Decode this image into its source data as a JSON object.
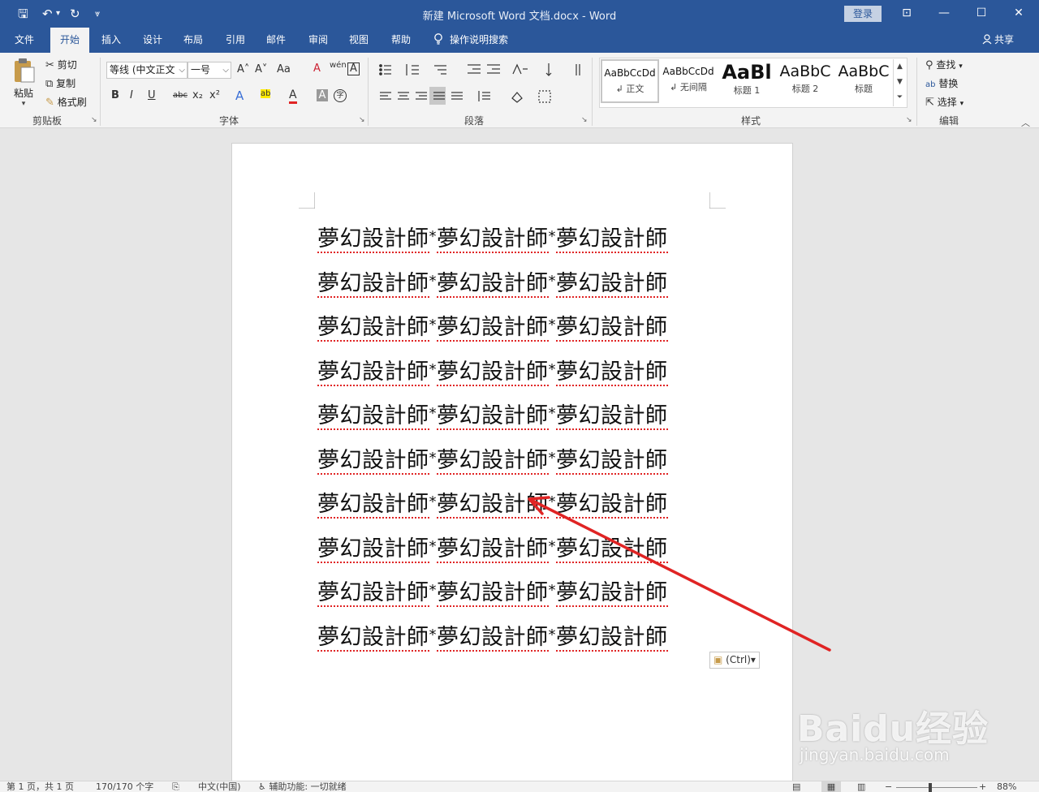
{
  "window": {
    "title": "新建 Microsoft Word 文档.docx  -  Word",
    "login_label": "登录",
    "controls": {
      "ribbon_display": "⊡",
      "minimize": "—",
      "maximize": "☐",
      "close": "✕"
    },
    "qat": {
      "save": "🖫",
      "undo": "↶",
      "undo_menu": "▾",
      "redo": "↻",
      "customize": "⩔"
    }
  },
  "tabs": {
    "file": "文件",
    "home": "开始",
    "insert": "插入",
    "design": "设计",
    "layout": "布局",
    "references": "引用",
    "mailings": "邮件",
    "review": "审阅",
    "view": "视图",
    "help": "帮助",
    "tell_me": "操作说明搜索",
    "share": "共享"
  },
  "ribbon": {
    "clipboard": {
      "label": "剪贴板",
      "paste": "粘贴",
      "cut": "剪切",
      "copy": "复制",
      "format_painter": "格式刷"
    },
    "font": {
      "label": "字体",
      "font_name": "等线 (中文正文",
      "font_size": "一号",
      "grow": "A˄",
      "shrink": "A˅",
      "change_case": "Aa",
      "clear": "A",
      "phonetic": "wén",
      "char_border": "A",
      "bold": "B",
      "italic": "I",
      "underline": "U",
      "strike": "abc",
      "sub": "x₂",
      "sup": "x²",
      "effects": "A",
      "highlight": "ab",
      "font_color": "A",
      "char_shade": "A",
      "enclose": "字"
    },
    "paragraph": {
      "label": "段落"
    },
    "styles": {
      "label": "样式",
      "items": [
        {
          "preview": "AaBbCcDd",
          "name": "↲ 正文"
        },
        {
          "preview": "AaBbCcDd",
          "name": "↲ 无间隔"
        },
        {
          "preview": "AaBl",
          "name": "标题 1"
        },
        {
          "preview": "AaBbC",
          "name": "标题 2"
        },
        {
          "preview": "AaBbC",
          "name": "标题"
        }
      ]
    },
    "editing": {
      "label": "编辑",
      "find": "查找",
      "replace": "替换",
      "select": "选择"
    }
  },
  "document": {
    "lines": [
      [
        "夢幻設計師",
        "*",
        "夢幻設計師",
        "*",
        "夢幻設計師"
      ],
      [
        "夢幻設計師",
        "*",
        "夢幻設計師",
        "*",
        "夢幻設計師"
      ],
      [
        "夢幻設計師",
        "*",
        "夢幻設計師",
        "*",
        "夢幻設計師"
      ],
      [
        "夢幻設計師",
        "*",
        "夢幻設計師",
        "*",
        "夢幻設計師"
      ],
      [
        "夢幻設計師",
        "*",
        "夢幻設計師",
        "*",
        "夢幻設計師"
      ],
      [
        "夢幻設計師",
        "*",
        "夢幻設計師",
        "*",
        "夢幻設計師"
      ],
      [
        "夢幻設計師",
        "*",
        "夢幻設計師",
        "*",
        "夢幻設計師"
      ],
      [
        "夢幻設計師",
        "*",
        "夢幻設計師",
        "*",
        "夢幻設計師"
      ],
      [
        "夢幻設計師",
        "*",
        "夢幻設計師",
        "*",
        "夢幻設計師"
      ],
      [
        "夢幻設計師",
        "*",
        "夢幻設計師",
        "*",
        "夢幻設計師"
      ]
    ],
    "paste_options": "(Ctrl)▾"
  },
  "watermark": {
    "logo": "Baidu经验",
    "url": "jingyan.baidu.com"
  },
  "statusbar": {
    "page": "第 1 页，共 1 页",
    "words": "170/170 个字",
    "language": "中文(中国)",
    "accessibility": "辅助功能: 一切就绪",
    "zoom": "88%"
  },
  "colors": {
    "brand": "#2b579a",
    "annotation_arrow": "#e02424",
    "spelling_squiggle": "#e02424"
  }
}
